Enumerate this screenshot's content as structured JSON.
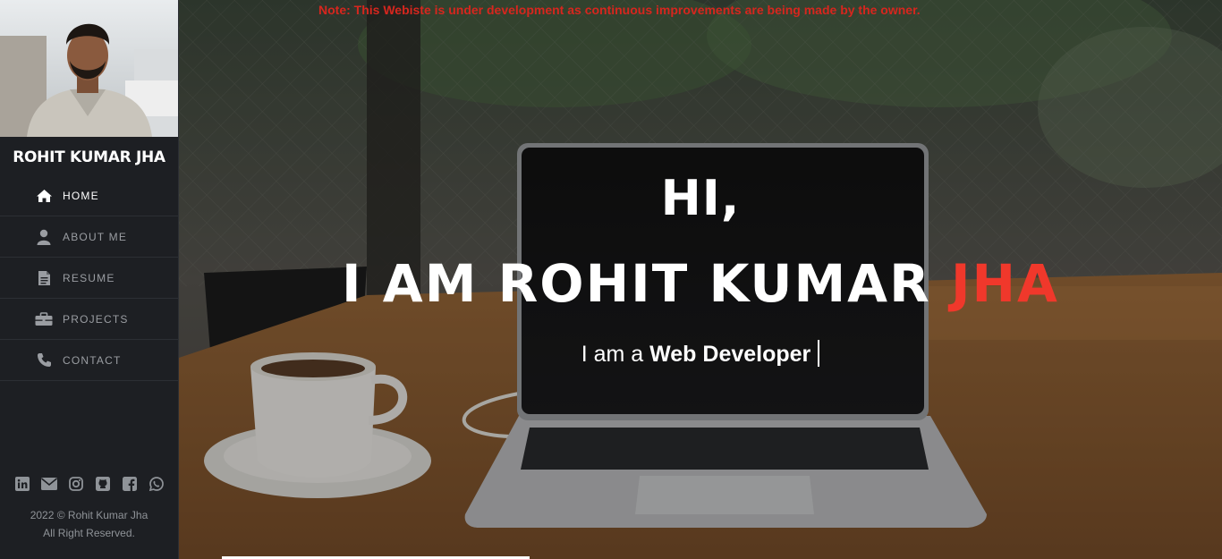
{
  "sidebar": {
    "name": "ROHIT KUMAR JHA",
    "nav": [
      {
        "label": "HOME",
        "icon": "home-icon",
        "active": true
      },
      {
        "label": "ABOUT ME",
        "icon": "user-icon",
        "active": false
      },
      {
        "label": "RESUME",
        "icon": "document-icon",
        "active": false
      },
      {
        "label": "PROJECTS",
        "icon": "briefcase-icon",
        "active": false
      },
      {
        "label": "CONTACT",
        "icon": "phone-icon",
        "active": false
      }
    ],
    "socials": [
      "linkedin-icon",
      "email-icon",
      "instagram-icon",
      "github-icon",
      "facebook-icon",
      "whatsapp-icon"
    ],
    "footer_line1": "2022 © Rohit Kumar Jha",
    "footer_line2": "All Right Reserved."
  },
  "hero": {
    "notice": "Note: This Webiste is under development as continuous improvements are being made by the owner.",
    "greeting": "HI,",
    "headline_prefix": "I AM ROHIT KUMAR ",
    "headline_accent": "JHA",
    "tagline_prefix": "I am a ",
    "tagline_role": "Web Developer"
  },
  "colors": {
    "accent": "#f0382b",
    "notice": "#d7261e",
    "sidebar_bg": "#1d1f23",
    "nav_text": "#9a9da2"
  }
}
